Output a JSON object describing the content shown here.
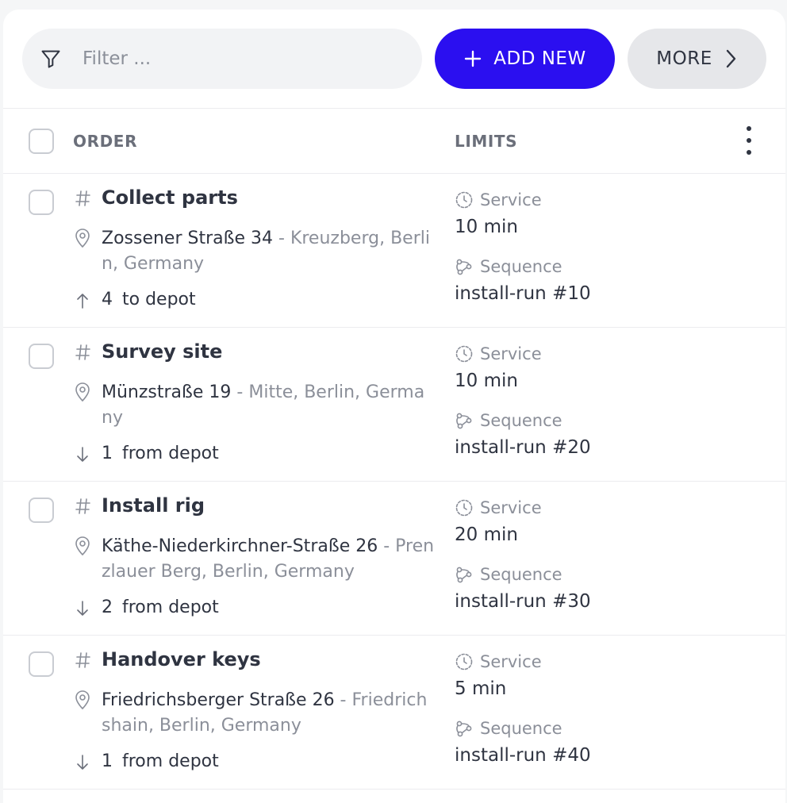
{
  "toolbar": {
    "filter_placeholder": "Filter ...",
    "add_new_label": "ADD NEW",
    "more_label": "MORE",
    "accent_color": "#2b0ff0"
  },
  "table": {
    "columns": [
      "ORDER",
      "LIMITS"
    ],
    "rows": [
      {
        "title": "Collect parts",
        "address_main": "Zossener Straße 34",
        "address_detail": " - Kreuzberg, Berlin, Germany",
        "count": "4",
        "direction": "to depot",
        "direction_icon": "arrow-up-icon",
        "service_label": "Service",
        "service_value": "10 min",
        "sequence_label": "Sequence",
        "sequence_value": "install-run #10"
      },
      {
        "title": "Survey site",
        "address_main": "Münzstraße 19",
        "address_detail": " - Mitte, Berlin, Germany",
        "count": "1",
        "direction": "from depot",
        "direction_icon": "arrow-down-icon",
        "service_label": "Service",
        "service_value": "10 min",
        "sequence_label": "Sequence",
        "sequence_value": "install-run #20"
      },
      {
        "title": "Install rig",
        "address_main": "Käthe-Niederkirchner-Straße 26",
        "address_detail": " - Prenzlauer Berg, Berlin, Germany",
        "count": "2",
        "direction": "from depot",
        "direction_icon": "arrow-down-icon",
        "service_label": "Service",
        "service_value": "20 min",
        "sequence_label": "Sequence",
        "sequence_value": "install-run #30"
      },
      {
        "title": "Handover keys",
        "address_main": "Friedrichsberger Straße 26",
        "address_detail": " - Friedrichshain, Berlin, Germany",
        "count": "1",
        "direction": "from depot",
        "direction_icon": "arrow-down-icon",
        "service_label": "Service",
        "service_value": "5 min",
        "sequence_label": "Sequence",
        "sequence_value": "install-run #40"
      }
    ]
  }
}
